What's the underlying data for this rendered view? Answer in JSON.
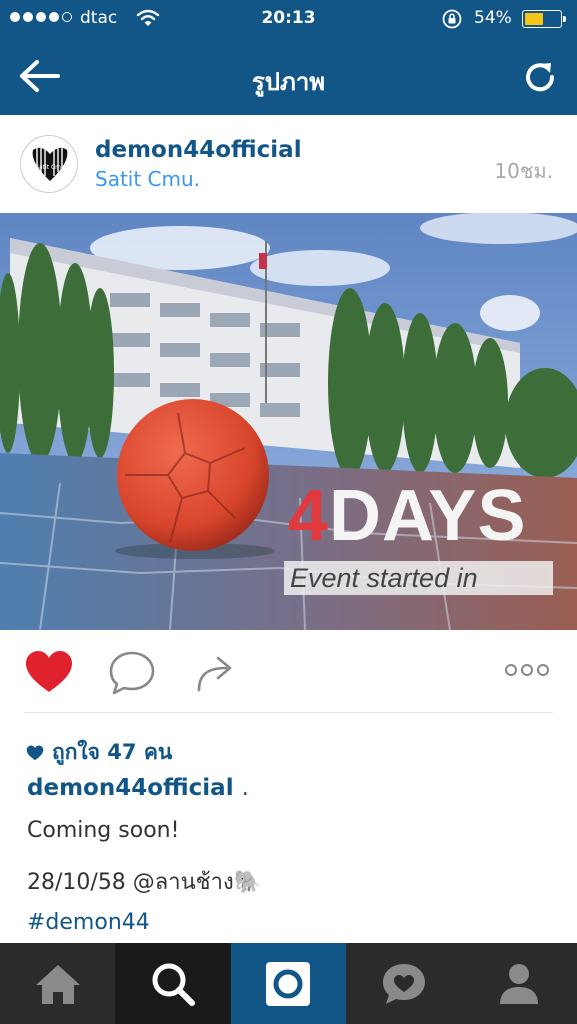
{
  "status_bar": {
    "carrier": "dtac",
    "time": "20:13",
    "battery_percent": "54%",
    "battery_level": 0.54
  },
  "header": {
    "title": "รูปภาพ"
  },
  "post": {
    "username": "demon44official",
    "location": "Satit Cmu.",
    "time_ago": "10ชม.",
    "avatar_text": "Satit Cmu",
    "photo_overlay": {
      "days_number": "4",
      "days_word": "DAYS",
      "caption": "Event started in"
    },
    "likes": "ถูกใจ 47 คน",
    "caption_user": "demon44official",
    "caption_dot": ".",
    "lines": [
      "Coming soon!",
      "28/10/58 @ลานช้าง🐘"
    ],
    "hashtag": "#demon44"
  },
  "colors": {
    "brand_blue": "#125688",
    "link_blue": "#3897f0",
    "like_red": "#e0222f",
    "tab_dark": "#2b2b2b"
  },
  "icons": {
    "back": "arrow-left-icon",
    "refresh": "refresh-icon",
    "like": "heart-icon",
    "comment": "comment-icon",
    "share": "share-icon",
    "more": "more-icon",
    "home": "home-icon",
    "search": "search-icon",
    "camera": "camera-icon",
    "activity": "activity-icon",
    "profile": "profile-icon"
  }
}
